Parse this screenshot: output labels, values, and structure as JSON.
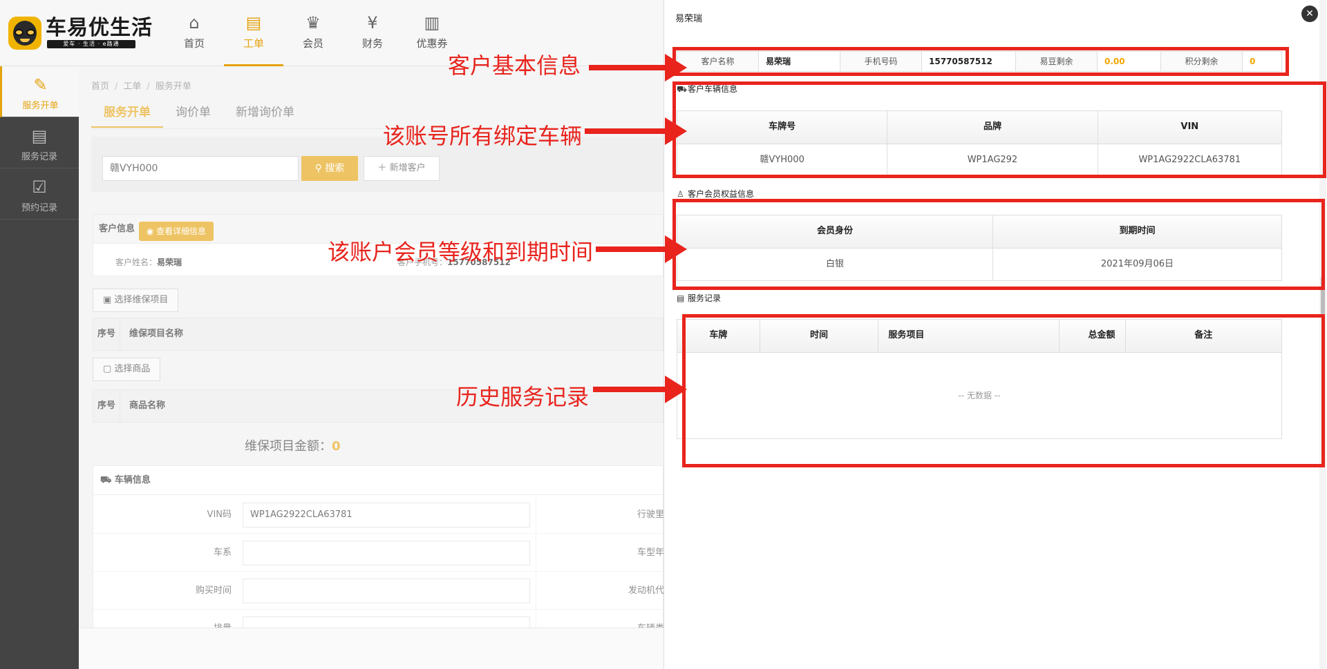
{
  "app": {
    "logo_title": "车易优生活",
    "logo_sub": "爱车 · 生活 · e路通"
  },
  "nav": [
    {
      "label": "首页",
      "icon": "home-icon"
    },
    {
      "label": "工单",
      "icon": "clipboard-icon"
    },
    {
      "label": "会员",
      "icon": "crown-icon"
    },
    {
      "label": "财务",
      "icon": "finance-icon"
    },
    {
      "label": "优惠券",
      "icon": "coupon-icon"
    }
  ],
  "sidebar": [
    {
      "label": "服务开单",
      "icon": "edit-document-icon"
    },
    {
      "label": "服务记录",
      "icon": "record-search-icon"
    },
    {
      "label": "预约记录",
      "icon": "check-document-icon"
    }
  ],
  "breadcrumb": [
    "首页",
    "工单",
    "服务开单"
  ],
  "tabs": [
    "服务开单",
    "询价单",
    "新增询价单"
  ],
  "search": {
    "value": "赣VYH000",
    "button": "搜索",
    "add_button": "新增客户"
  },
  "customer": {
    "section_title": "客户信息",
    "view_detail": "查看详细信息",
    "name_label": "客户姓名：",
    "name": "易荣瑞",
    "phone_label": "客户手机号：",
    "phone": "15770587512"
  },
  "maintenance": {
    "select_button": "选择维保项目",
    "col_no": "序号",
    "col_name": "维保项目名称"
  },
  "goods": {
    "select_button": "选择商品",
    "col_no": "序号",
    "col_name": "商品名称"
  },
  "amount": {
    "label": "维保项目金额：",
    "value": "0"
  },
  "vehicle": {
    "title": "车辆信息",
    "rows": [
      {
        "label": "VIN码",
        "value": "WP1AG2922CLA63781",
        "label2": "行驶里"
      },
      {
        "label": "车系",
        "value": "",
        "label2": "车型年"
      },
      {
        "label": "购买时间",
        "value": "",
        "label2": "发动机代"
      },
      {
        "label": "排量",
        "value": "",
        "label2": "车辆类"
      }
    ]
  },
  "annotations": [
    "客户基本信息",
    "该账号所有绑定车辆",
    "该账户会员等级和到期时间",
    "历史服务记录"
  ],
  "drawer": {
    "title": "易荣瑞",
    "close": "✕",
    "info": [
      {
        "label": "客户名称",
        "value": "易荣瑞",
        "gold": false
      },
      {
        "label": "手机号码",
        "value": "15770587512",
        "gold": false
      },
      {
        "label": "易豆剩余",
        "value": "0.00",
        "gold": true
      },
      {
        "label": "积分剩余",
        "value": "0",
        "gold": true
      }
    ],
    "vehicles": {
      "title": "客户车辆信息",
      "headers": [
        "车牌号",
        "品牌",
        "VIN"
      ],
      "rows": [
        [
          "赣VYH000",
          "WP1AG292",
          "WP1AG2922CLA63781"
        ]
      ]
    },
    "membership": {
      "title": "客户会员权益信息",
      "headers": [
        "会员身份",
        "到期时间"
      ],
      "rows": [
        [
          "白银",
          "2021年09月06日"
        ]
      ]
    },
    "services": {
      "title": "服务记录",
      "headers": [
        "车牌",
        "时间",
        "服务项目",
        "总金额",
        "备注"
      ],
      "empty": "-- 无数据 --"
    }
  },
  "colors": {
    "accent": "#e5a310",
    "annotation": "#e8241d",
    "sidebar_bg": "#444444"
  }
}
